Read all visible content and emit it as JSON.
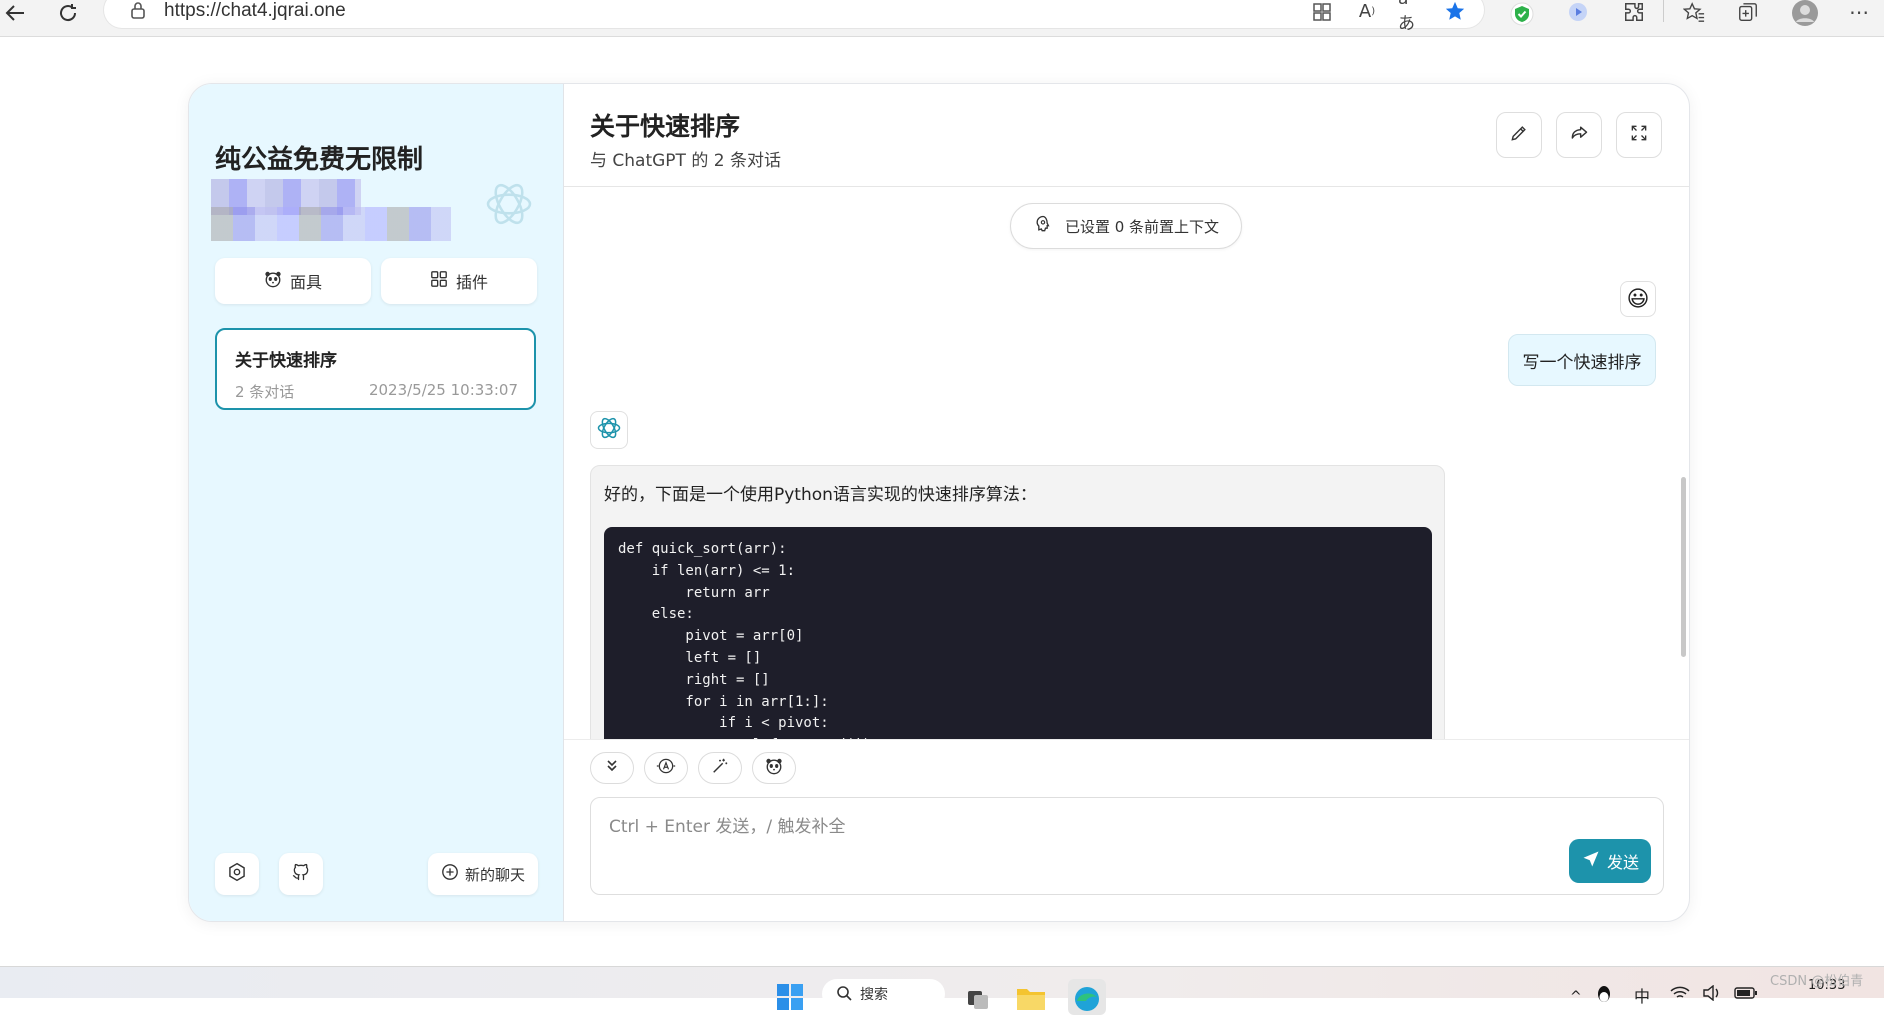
{
  "browser": {
    "url": "https://chat4.jqrai.one"
  },
  "sidebar": {
    "title": "纯公益免费无限制",
    "mask_button": "面具",
    "plugin_button": "插件",
    "chats": [
      {
        "title": "关于快速排序",
        "count": "2 条对话",
        "date": "2023/5/25 10:33:07"
      }
    ],
    "new_chat_button": "新的聊天"
  },
  "header": {
    "title": "关于快速排序",
    "subtitle": "与 ChatGPT 的 2 条对话"
  },
  "messages": {
    "context_pill": "已设置 0 条前置上下文",
    "user_emoji": "😃",
    "user_message": "写一个快速排序",
    "bot_intro": "好的，下面是一个使用Python语言实现的快速排序算法：",
    "bot_code": "def quick_sort(arr):\n    if len(arr) <= 1:\n        return arr\n    else:\n        pivot = arr[0]\n        left = []\n        right = []\n        for i in arr[1:]:\n            if i < pivot:\n                left.append(i)\n            else:\n                right.append(i)\n        return quick_sort(left) + [pivot] + quick_sort(right)"
  },
  "input": {
    "placeholder": "Ctrl + Enter 发送，/ 触发补全",
    "send_button": "发送"
  },
  "taskbar": {
    "search_label": "搜索",
    "time": "10:33",
    "input_method": "中"
  },
  "watermark": "CSDN @松伯青",
  "colors": {
    "accent": "#1d93ab",
    "sidebar_bg": "#e7f8ff",
    "code_bg": "#1e1e2a"
  }
}
